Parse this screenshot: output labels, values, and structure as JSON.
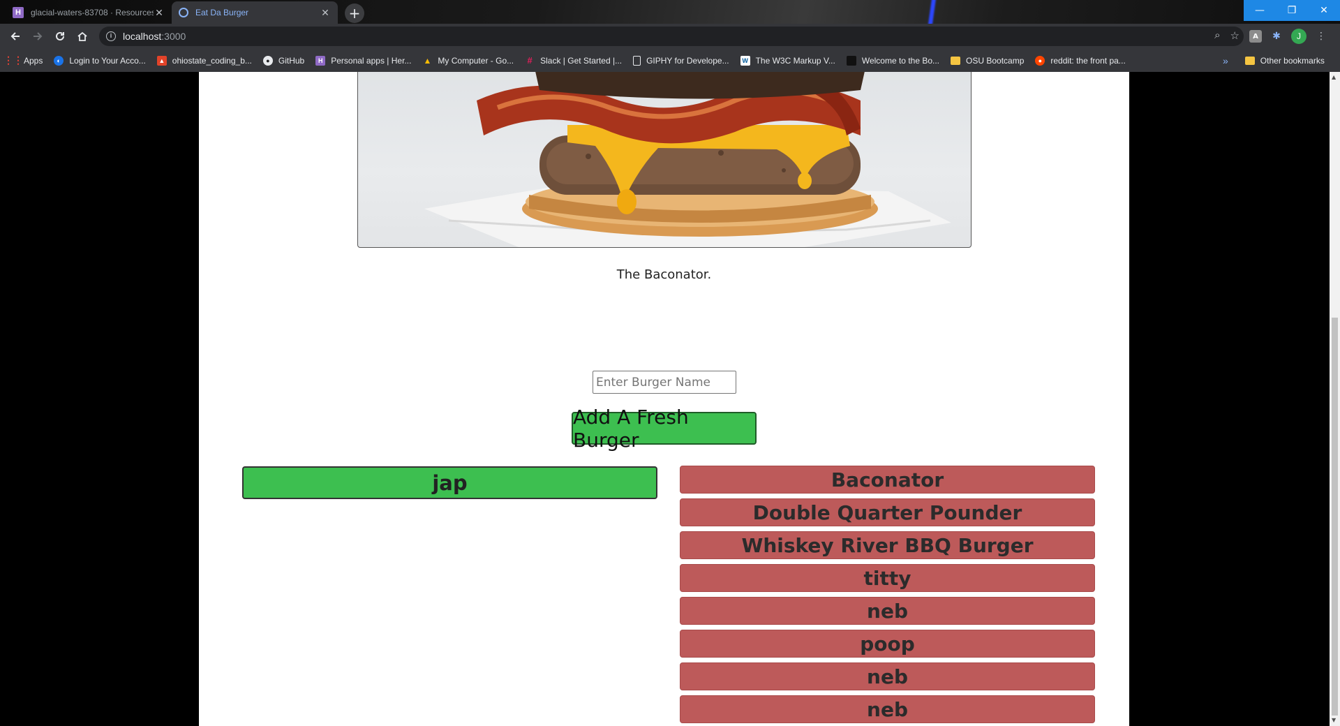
{
  "tabs": [
    {
      "title": "glacial-waters-83708 · Resources",
      "favicon": "H",
      "state": "inactive"
    },
    {
      "title": "Eat Da Burger",
      "favicon": "globe",
      "state": "active"
    }
  ],
  "address": {
    "host": "localhost",
    "port": ":3000"
  },
  "profile_initial": "J",
  "bookmarks": [
    {
      "label": "Apps",
      "icon": "apps-grid-icon"
    },
    {
      "label": "Login to Your Acco...",
      "icon": "globe-icon"
    },
    {
      "label": "ohiostate_coding_b...",
      "icon": "gitlab-icon"
    },
    {
      "label": "GitHub",
      "icon": "github-icon"
    },
    {
      "label": "Personal apps | Her...",
      "icon": "heroku-icon"
    },
    {
      "label": "My Computer - Go...",
      "icon": "google-drive-icon"
    },
    {
      "label": "Slack | Get Started |...",
      "icon": "slack-icon"
    },
    {
      "label": "GIPHY for Develope...",
      "icon": "page-icon"
    },
    {
      "label": "The W3C Markup V...",
      "icon": "w3c-icon"
    },
    {
      "label": "Welcome to the Bo...",
      "icon": "book-icon"
    },
    {
      "label": "OSU Bootcamp",
      "icon": "folder-icon"
    },
    {
      "label": "reddit: the front pa...",
      "icon": "reddit-icon"
    }
  ],
  "bookmarks_more": "»",
  "other_bookmarks": "Other bookmarks",
  "page": {
    "caption": "The Baconator.",
    "input_placeholder": "Enter Burger Name",
    "add_button": "Add A Fresh Burger",
    "devoured": [
      "jap"
    ],
    "not_devoured": [
      "Baconator",
      "Double Quarter Pounder",
      "Whiskey River BBQ Burger",
      "titty",
      "neb",
      "poop",
      "neb",
      "neb"
    ]
  },
  "colors": {
    "devoured": "#3dbf50",
    "not_devoured": "#bd5a5a",
    "add_button": "#3dbf50"
  }
}
